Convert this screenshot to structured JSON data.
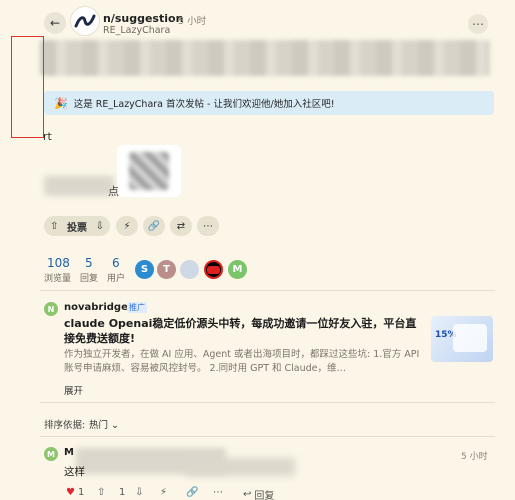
{
  "header": {
    "community": "n/suggestion",
    "time": "5 小时",
    "author": "RE_LazyChara",
    "more_icon": "ellipsis-icon"
  },
  "banner": {
    "text": "这是 RE_LazyChara 首次发帖 - 让我们欢迎他/她加入社区吧!",
    "icon": "party-popper-icon"
  },
  "body": {
    "fragment": "rt",
    "trailing": "点"
  },
  "actions": {
    "vote_label": "投票",
    "buttons": [
      "boost-icon",
      "link-icon",
      "share-icon",
      "more-icon"
    ]
  },
  "stats": {
    "views": "108",
    "views_label": "浏览量",
    "replies": "5",
    "replies_label": "回复",
    "users": "6",
    "users_label": "用户",
    "avatars": [
      {
        "letter": "S",
        "color": "#2a8bd1"
      },
      {
        "letter": "T",
        "color": "#b98e8b"
      },
      {
        "letter": "",
        "color": "#cfd8e6"
      },
      {
        "letter": "",
        "color": "#e02020"
      },
      {
        "letter": "M",
        "color": "#7bc46a"
      }
    ]
  },
  "ad": {
    "avatar_letter": "N",
    "name": "novabridge",
    "tag": "推广",
    "title": "claude Openai稳定低价源头中转，每成功邀请一位好友入驻，平台直接免费送额度!",
    "desc": "作为独立开发者，在做 AI 应用、Agent 或者出海项目时，都踩过这些坑: 1.官方 API 账号申请麻烦、容易被风控封号。 2.同时用 GPT 和 Claude，维…",
    "expand": "展开",
    "image_text": "15%"
  },
  "sort": {
    "label": "排序依据:",
    "value": "热门"
  },
  "reply": {
    "avatar_letter": "M",
    "name": "M",
    "time": "5 小时",
    "text": "这样",
    "likes": "1",
    "upvotes": "1",
    "reply_label": "回复"
  }
}
